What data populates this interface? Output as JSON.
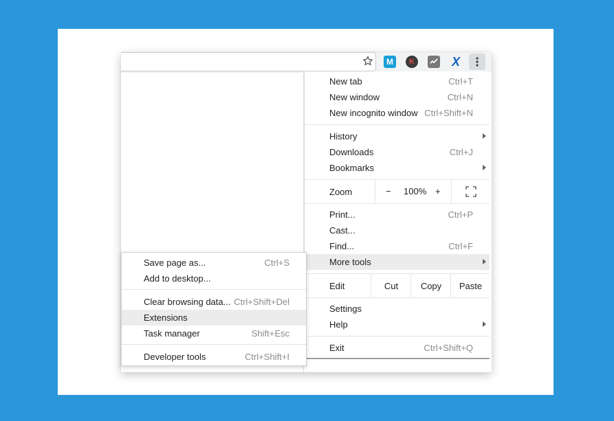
{
  "colors": {
    "background": "#2b96d9",
    "card": "#ffffff",
    "highlight": "#ececec"
  },
  "toolbar": {
    "icons": [
      "star-icon",
      "extension-m-icon",
      "extension-k-icon",
      "extension-check-icon",
      "extension-x-icon",
      "menu-kebab-icon"
    ],
    "ext_m": "M",
    "ext_k": "K",
    "ext_x": "X"
  },
  "menu": {
    "new_tab": {
      "label": "New tab",
      "shortcut": "Ctrl+T"
    },
    "new_window": {
      "label": "New window",
      "shortcut": "Ctrl+N"
    },
    "new_incognito": {
      "label": "New incognito window",
      "shortcut": "Ctrl+Shift+N"
    },
    "history": {
      "label": "History"
    },
    "downloads": {
      "label": "Downloads",
      "shortcut": "Ctrl+J"
    },
    "bookmarks": {
      "label": "Bookmarks"
    },
    "zoom": {
      "label": "Zoom",
      "minus": "−",
      "value": "100%",
      "plus": "+"
    },
    "print": {
      "label": "Print...",
      "shortcut": "Ctrl+P"
    },
    "cast": {
      "label": "Cast..."
    },
    "find": {
      "label": "Find...",
      "shortcut": "Ctrl+F"
    },
    "more_tools": {
      "label": "More tools"
    },
    "edit": {
      "label": "Edit",
      "cut": "Cut",
      "copy": "Copy",
      "paste": "Paste"
    },
    "settings": {
      "label": "Settings"
    },
    "help": {
      "label": "Help"
    },
    "exit": {
      "label": "Exit",
      "shortcut": "Ctrl+Shift+Q"
    }
  },
  "submenu": {
    "save_page": {
      "label": "Save page as...",
      "shortcut": "Ctrl+S"
    },
    "add_desktop": {
      "label": "Add to desktop..."
    },
    "clear_data": {
      "label": "Clear browsing data...",
      "shortcut": "Ctrl+Shift+Del"
    },
    "extensions": {
      "label": "Extensions"
    },
    "task_manager": {
      "label": "Task manager",
      "shortcut": "Shift+Esc"
    },
    "dev_tools": {
      "label": "Developer tools",
      "shortcut": "Ctrl+Shift+I"
    }
  }
}
